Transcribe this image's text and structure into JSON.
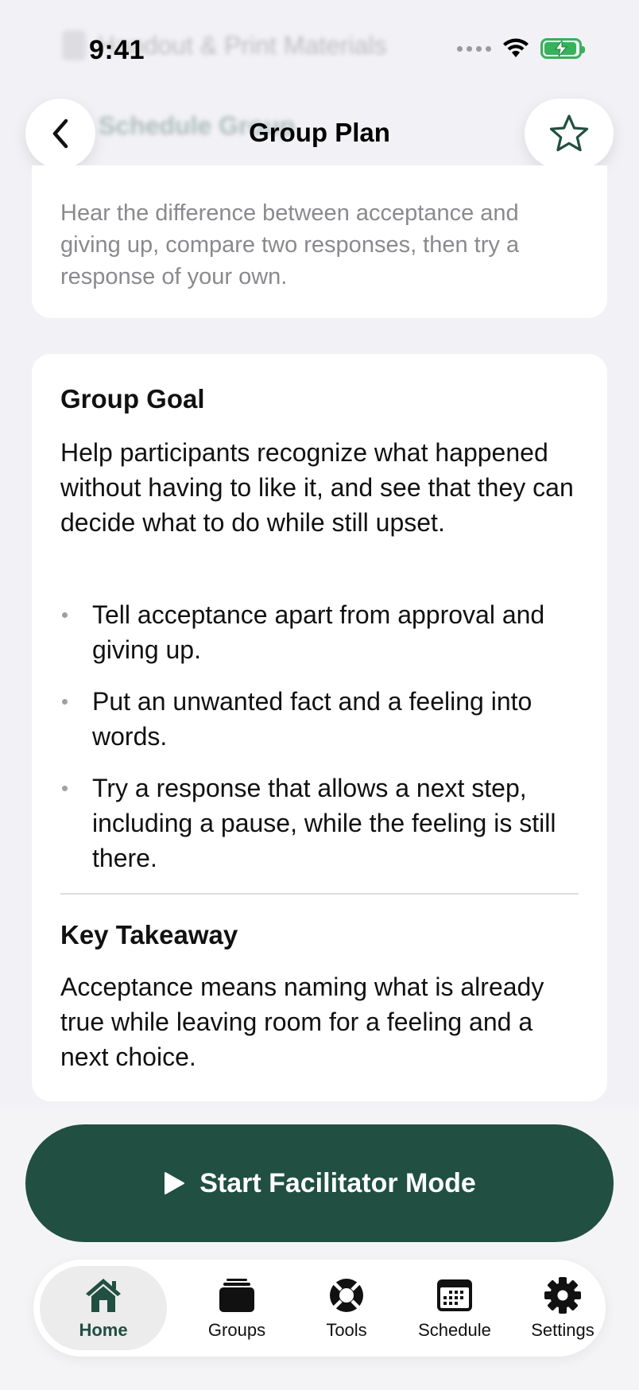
{
  "status_bar": {
    "time": "9:41"
  },
  "background_ghost": {
    "row1": "Handout & Print Materials",
    "row2": "Schedule Group"
  },
  "nav": {
    "title": "Group Plan"
  },
  "summary": {
    "text": "Hear the difference between acceptance and giving up, compare two responses, then try a response of your own."
  },
  "goal": {
    "title": "Group Goal",
    "description": "Help participants recognize what happened without having to like it, and see that they can decide what to do while still upset.",
    "bullets": [
      "Tell acceptance apart from approval and giving up.",
      "Put an unwanted fact and a feeling into words.",
      "Try a response that allows a next step, including a pause, while the feeling is still there."
    ]
  },
  "takeaway": {
    "title": "Key Takeaway",
    "text": "Acceptance means naming what is already true while leaving room for a feeling and a next choice."
  },
  "primary_action": {
    "label": "Start Facilitator Mode",
    "icon": "play-icon"
  },
  "tabs": [
    {
      "label": "Home",
      "icon": "house-icon",
      "active": true
    },
    {
      "label": "Groups",
      "icon": "stack-icon",
      "active": false
    },
    {
      "label": "Tools",
      "icon": "lifebuoy-icon",
      "active": false
    },
    {
      "label": "Schedule",
      "icon": "calendar-icon",
      "active": false
    },
    {
      "label": "Settings",
      "icon": "gear-icon",
      "active": false
    }
  ],
  "colors": {
    "accent": "#214f41",
    "background": "#f2f2f6",
    "battery": "#39b15a"
  }
}
